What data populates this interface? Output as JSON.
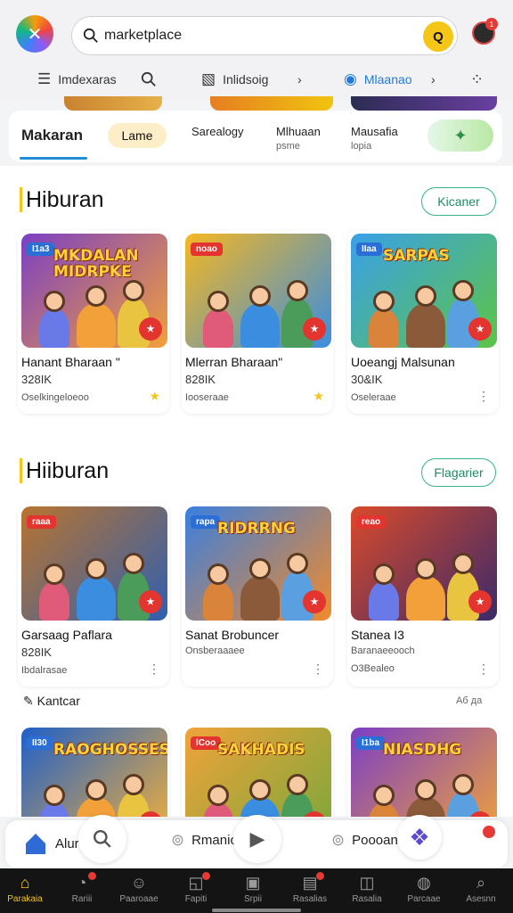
{
  "search": {
    "value": "marketplace",
    "go_label": "Q"
  },
  "header": {
    "avatar_badge": "1"
  },
  "subnav": [
    {
      "label": "Imdexaras",
      "icon": "list-icon"
    },
    {
      "label": "",
      "icon": "search-icon"
    },
    {
      "label": "Inlidsoig",
      "icon": "chart-icon"
    },
    {
      "label": "Mlaanao",
      "icon": "info-icon"
    }
  ],
  "tabs": {
    "active": "Makaran",
    "pill": "Lame",
    "items": [
      {
        "label": "Sarealogy",
        "sub": ""
      },
      {
        "label": "Mlhuaan",
        "sub": "psme"
      },
      {
        "label": "Mausafia",
        "sub": "lopia"
      }
    ]
  },
  "sections": [
    {
      "title": "Hiburan",
      "button": "Kicaner",
      "cards": [
        {
          "tag": "I1a3",
          "art": "MKDALAN MIDRPKE",
          "title": "Hanant Bharaan \"",
          "count": "328IK",
          "meta": "Oselkingeloeoo",
          "colors": [
            "#7b3fc4",
            "#f2a03a"
          ]
        },
        {
          "tag": "noao",
          "art": "",
          "title": "Mlerran Bharaan\"",
          "count": "828IK",
          "meta": "Iooseraae",
          "colors": [
            "#f5b721",
            "#3b8de0"
          ]
        },
        {
          "tag": "IIaa",
          "art": "SARPAS",
          "title": "Uoeangj Malsunan",
          "count": "30&IK",
          "meta": "Oseleraae",
          "colors": [
            "#3aa0e8",
            "#5cc447"
          ]
        }
      ]
    },
    {
      "title": "Hiiburan",
      "button": "Flagarier",
      "cards": [
        {
          "tag": "raaa",
          "art": "",
          "title": "Garsaag Paflara",
          "count": "828IK",
          "meta": "Ibdalrasae",
          "colors": [
            "#b9742f",
            "#2f5fb0"
          ]
        },
        {
          "tag": "rapa",
          "art": "RIDRRNG",
          "title": "Sanat Brobuncer",
          "count": "",
          "meta": "Onsberaaaee",
          "colors": [
            "#3a7fe0",
            "#f08a2c"
          ]
        },
        {
          "tag": "reao",
          "art": "",
          "title": "Stanea I3",
          "count": "",
          "meta": "Baranaeeooch",
          "meta2": "O3Bealeo",
          "colors": [
            "#d94a2a",
            "#3b2a6a"
          ]
        }
      ]
    }
  ],
  "small_section": {
    "title": "Kantcar",
    "right": "Аб да"
  },
  "row3": [
    {
      "tag": "II30",
      "art": "RAOGHOSSES",
      "colors": [
        "#1f5fc9",
        "#f2b03a"
      ]
    },
    {
      "tag": "lCoo",
      "art": "SAKHADIS",
      "colors": [
        "#f0a33a",
        "#7aa73a"
      ]
    },
    {
      "tag": "I1ba",
      "art": "NIASDHG",
      "colors": [
        "#7b3fc4",
        "#f0a33a"
      ]
    }
  ],
  "floatbar": {
    "item1": "Alur",
    "item2": "Rmanio",
    "item3": "Poooan"
  },
  "bottomnav": [
    {
      "label": "Parakaia",
      "icon": "home-icon",
      "active": true
    },
    {
      "label": "Rariii",
      "icon": "clock-icon"
    },
    {
      "label": "Paaroaae",
      "icon": "person-icon"
    },
    {
      "label": "Fapiti",
      "icon": "chart-icon"
    },
    {
      "label": "Srpii",
      "icon": "square-icon"
    },
    {
      "label": "Rasalias",
      "icon": "cart-icon"
    },
    {
      "label": "Rasalia",
      "icon": "bag-icon"
    },
    {
      "label": "Parcaae",
      "icon": "globe-icon"
    },
    {
      "label": "Asesnn",
      "icon": "search-icon"
    }
  ],
  "colors": {
    "accent": "#1f8ed6",
    "brand_yellow": "#f5c518",
    "outline_green": "#3bb38a"
  }
}
